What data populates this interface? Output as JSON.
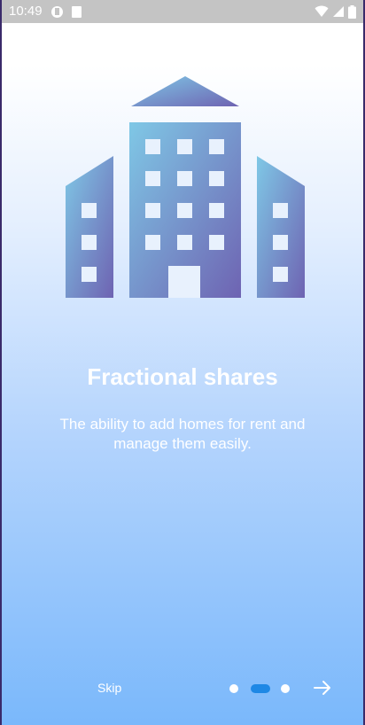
{
  "statusbar": {
    "time": "10:49"
  },
  "onboarding": {
    "title": "Fractional shares",
    "description": "The ability to add homes for rent and manage them easily."
  },
  "footer": {
    "skip_label": "Skip",
    "page_count": 3,
    "active_page": 2
  },
  "colors": {
    "accent": "#1e88e5",
    "building_top": "#7fc8e6",
    "building_bottom": "#6e63b2"
  },
  "icons": [
    "building-illustration",
    "arrow-right-icon"
  ]
}
